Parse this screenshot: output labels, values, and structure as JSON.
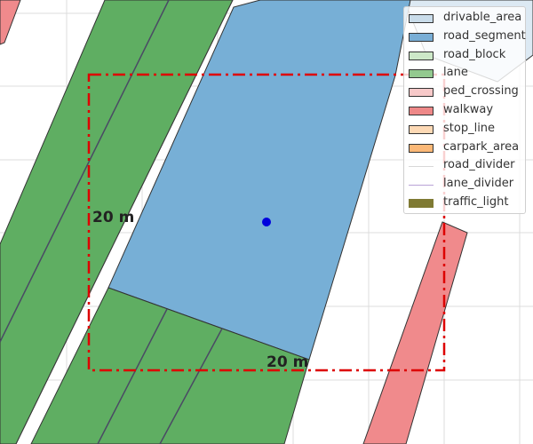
{
  "map": {
    "scale_labels": {
      "vertical": "20 m",
      "horizontal": "20 m"
    }
  },
  "legend": {
    "items": [
      {
        "label": "drivable_area",
        "kind": "patch",
        "fill": "#c9dcea",
        "stroke": "#333333"
      },
      {
        "label": "road_segment",
        "kind": "patch",
        "fill": "#79aed6",
        "stroke": "#333333"
      },
      {
        "label": "road_block",
        "kind": "patch",
        "fill": "#cde8c8",
        "stroke": "#333333"
      },
      {
        "label": "lane",
        "kind": "patch",
        "fill": "#93c98f",
        "stroke": "#333333"
      },
      {
        "label": "ped_crossing",
        "kind": "patch",
        "fill": "#f7c9c9",
        "stroke": "#333333"
      },
      {
        "label": "walkway",
        "kind": "patch",
        "fill": "#ee8888",
        "stroke": "#333333"
      },
      {
        "label": "stop_line",
        "kind": "patch",
        "fill": "#fdd9b5",
        "stroke": "#333333"
      },
      {
        "label": "carpark_area",
        "kind": "patch",
        "fill": "#fbb877",
        "stroke": "#333333"
      },
      {
        "label": "road_divider",
        "kind": "line",
        "color": "#d8d8d8"
      },
      {
        "label": "lane_divider",
        "kind": "line",
        "color": "#b9a3d6"
      },
      {
        "label": "traffic_light",
        "kind": "patch",
        "fill": "#7f7a33",
        "stroke": "#7f7a33"
      }
    ]
  },
  "colors": {
    "lane_fill": "#5fae62",
    "road_segment_fill": "#77afd6",
    "drivable_area_fill": "#dce9f3",
    "walkway_fill": "#f08a8c",
    "ego_marker": "#0000dd",
    "range_box": "#dd0000"
  }
}
